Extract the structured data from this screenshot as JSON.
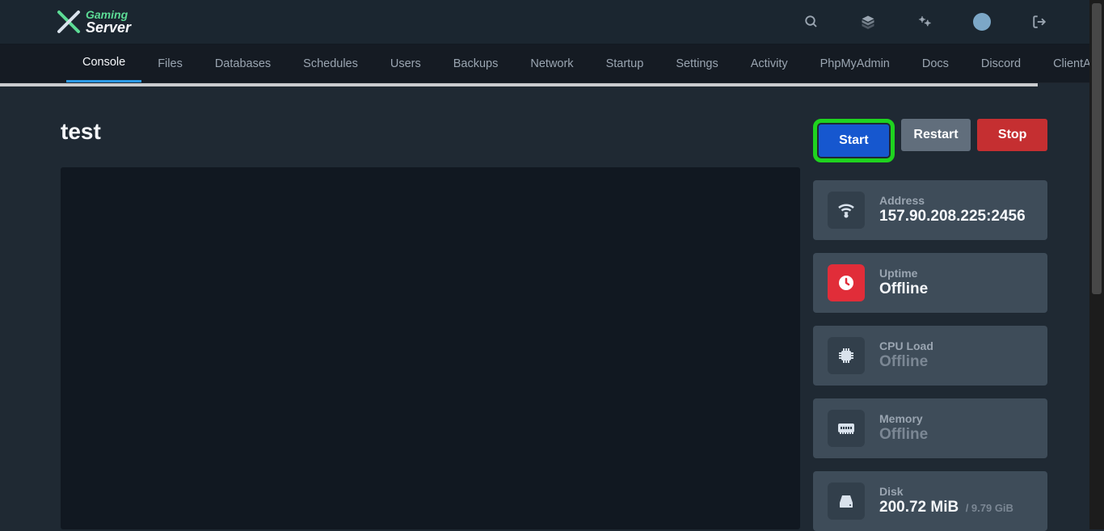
{
  "brand": {
    "line1": "Gaming",
    "line2": "Server"
  },
  "topicons": {
    "search": "search-icon",
    "layers": "layers-icon",
    "admin": "admin-cogs-icon",
    "avatar": "user-avatar",
    "logout": "logout-icon"
  },
  "nav": {
    "items": [
      {
        "label": "Console",
        "active": true
      },
      {
        "label": "Files"
      },
      {
        "label": "Databases"
      },
      {
        "label": "Schedules"
      },
      {
        "label": "Users"
      },
      {
        "label": "Backups"
      },
      {
        "label": "Network"
      },
      {
        "label": "Startup"
      },
      {
        "label": "Settings"
      },
      {
        "label": "Activity"
      },
      {
        "label": "PhpMyAdmin"
      },
      {
        "label": "Docs"
      },
      {
        "label": "Discord"
      },
      {
        "label": "ClientArea"
      }
    ]
  },
  "server": {
    "name": "test"
  },
  "buttons": {
    "start": "Start",
    "restart": "Restart",
    "stop": "Stop"
  },
  "stats": {
    "address": {
      "label": "Address",
      "value": "157.90.208.225:2456"
    },
    "uptime": {
      "label": "Uptime",
      "value": "Offline"
    },
    "cpu": {
      "label": "CPU Load",
      "value": "Offline"
    },
    "memory": {
      "label": "Memory",
      "value": "Offline"
    },
    "disk": {
      "label": "Disk",
      "value": "200.72 MiB",
      "sub": "/ 9.79 GiB"
    }
  },
  "highlight": {
    "target": "start-button"
  }
}
